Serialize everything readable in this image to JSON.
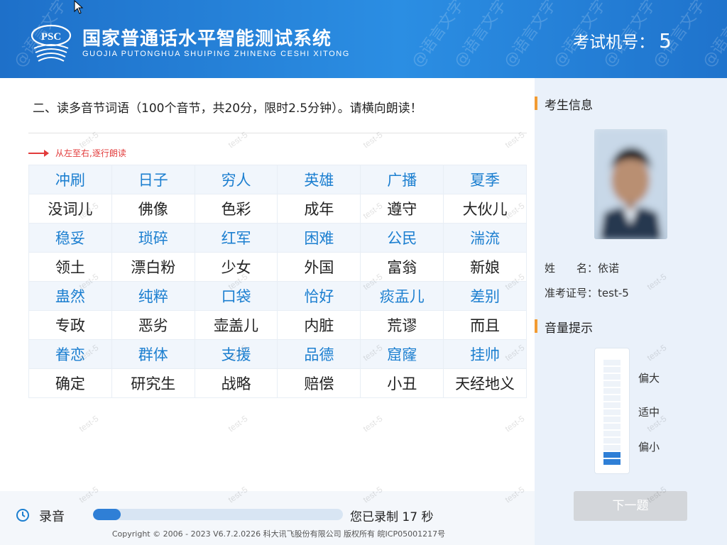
{
  "header": {
    "logo_text": "PSC",
    "title_cn": "国家普通话水平智能测试系统",
    "title_en": "GUOJIA PUTONGHUA SHUIPING ZHINENG CESHI XITONG",
    "machine_label": "考试机号：",
    "machine_number": "5",
    "watermark": "@语言文字"
  },
  "main": {
    "instruction": "二、读多音节词语（100个音节，共20分，限时2.5分钟）。请横向朗读！",
    "hint": "从左至右,逐行朗读",
    "watermark": "test-5",
    "rows": [
      [
        "冲刷",
        "日子",
        "穷人",
        "英雄",
        "广播",
        "夏季"
      ],
      [
        "没词儿",
        "佛像",
        "色彩",
        "成年",
        "遵守",
        "大伙儿"
      ],
      [
        "稳妥",
        "琐碎",
        "红军",
        "困难",
        "公民",
        "湍流"
      ],
      [
        "领土",
        "漂白粉",
        "少女",
        "外国",
        "富翁",
        "新娘"
      ],
      [
        "蛊然",
        "纯粹",
        "口袋",
        "恰好",
        "痰盂儿",
        "差别"
      ],
      [
        "专政",
        "恶劣",
        "壶盖儿",
        "内脏",
        "荒谬",
        "而且"
      ],
      [
        "眷恋",
        "群体",
        "支援",
        "品德",
        "窟窿",
        "挂帅"
      ],
      [
        "确定",
        "研究生",
        "战略",
        "赔偿",
        "小丑",
        "天经地义"
      ]
    ]
  },
  "sidebar": {
    "candidate_title": "考生信息",
    "name_label": "姓　　名：",
    "name_value": "依诺",
    "id_label": "准考证号：",
    "id_value": "test-5",
    "volume_title": "音量提示",
    "volume_high": "偏大",
    "volume_mid": "适中",
    "volume_low": "偏小",
    "volume_level": 0.13,
    "next_button": "下一题"
  },
  "recording": {
    "label": "录音",
    "progress": 0.11,
    "status": "您已录制 17 秒"
  },
  "footer": {
    "copyright": "Copyright © 2006 - 2023 V6.7.2.0226 科大讯飞股份有限公司 版权所有 皖ICP05001217号"
  },
  "colors": {
    "header_blue": "#1e70c9",
    "accent_blue": "#1c7fd0",
    "hint_red": "#e23b3b",
    "section_orange": "#f29b32"
  }
}
